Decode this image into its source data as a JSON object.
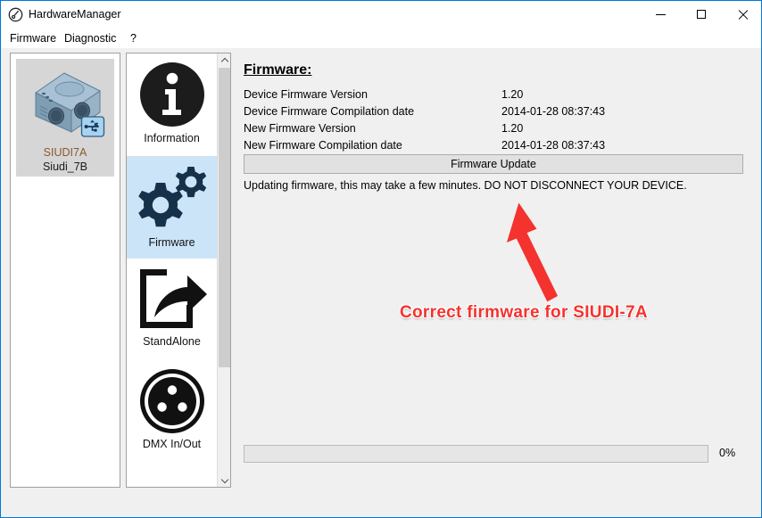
{
  "window": {
    "title": "HardwareManager",
    "app_icon": "wrench-circle-icon",
    "controls": {
      "minimize": "minimize-icon",
      "maximize": "maximize-icon",
      "close": "close-icon"
    }
  },
  "menubar": {
    "items": [
      {
        "label": "Firmware"
      },
      {
        "label": "Diagnostic"
      },
      {
        "label": "?"
      }
    ]
  },
  "device_panel": {
    "devices": [
      {
        "model": "SIUDI7A",
        "name": "Siudi_7B",
        "icon": "device-box-icon",
        "connection_badge": "usb-icon",
        "selected": true
      }
    ]
  },
  "nav_panel": {
    "items": [
      {
        "label": "Information",
        "icon": "info-circle-icon",
        "selected": false
      },
      {
        "label": "Firmware",
        "icon": "gears-icon",
        "selected": true
      },
      {
        "label": "StandAlone",
        "icon": "export-arrow-icon",
        "selected": false
      },
      {
        "label": "DMX In/Out",
        "icon": "xlr-connector-icon",
        "selected": false
      }
    ],
    "scrollbar": {
      "up_icon": "chevron-up-icon",
      "down_icon": "chevron-down-icon"
    }
  },
  "content": {
    "section_title": "Firmware:",
    "rows": [
      {
        "label": "Device Firmware Version",
        "value": "1.20"
      },
      {
        "label": "Device Firmware Compilation date",
        "value": "2014-01-28 08:37:43"
      },
      {
        "label": "New Firmware Version",
        "value": "1.20"
      },
      {
        "label": "New Firmware Compilation date",
        "value": "2014-01-28 08:37:43"
      }
    ],
    "update_button_label": "Firmware Update",
    "status_message": "Updating firmware, this may take a few minutes. DO NOT DISCONNECT YOUR DEVICE.",
    "progress": {
      "percent_label": "0%",
      "value": 0
    }
  },
  "annotations": {
    "arrow": {
      "icon": "red-arrow-up-icon",
      "color": "#f4322e"
    },
    "text": "Correct firmware for SIUDI-7A"
  },
  "colors": {
    "accent": "#0078d7",
    "selection_nav": "#cce4f7",
    "selection_device": "#d6d6d6",
    "annotation_red": "#f4322e",
    "window_bg": "#f0f0f0"
  }
}
